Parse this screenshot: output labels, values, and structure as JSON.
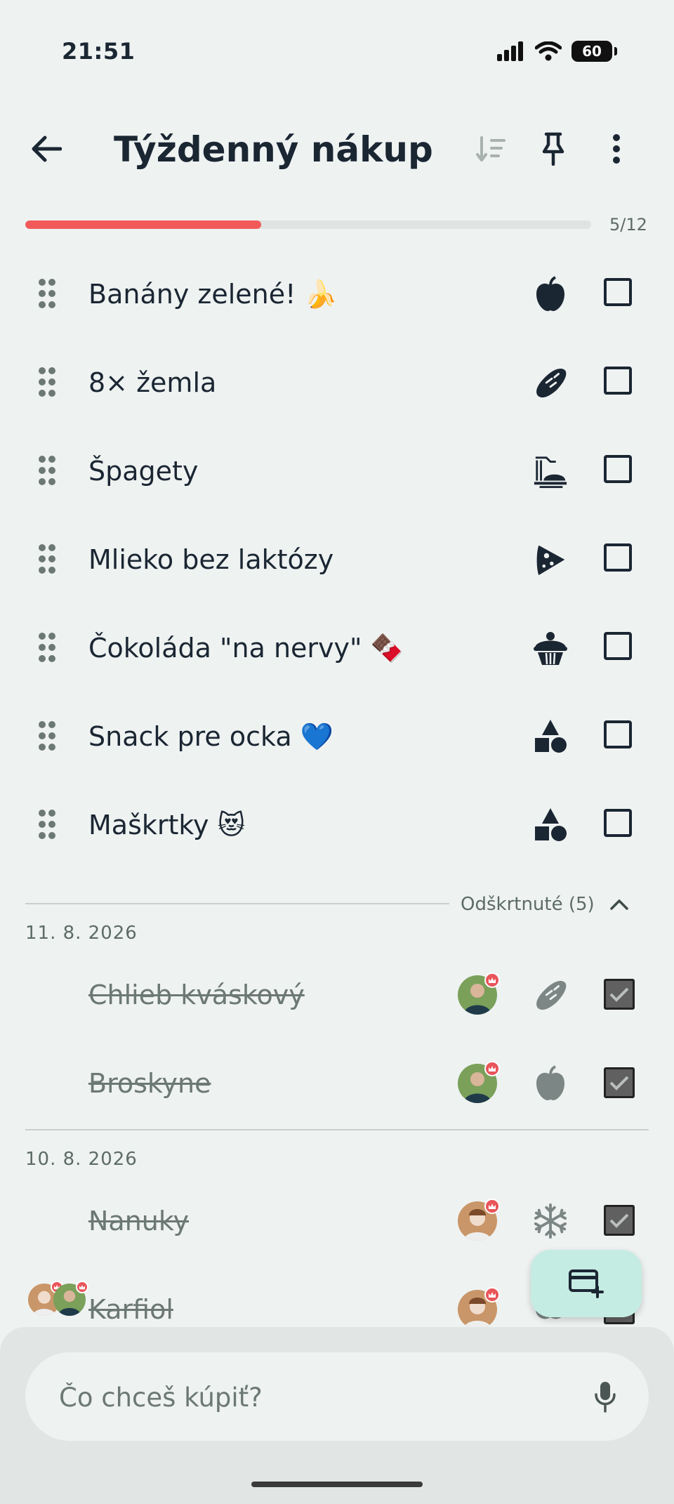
{
  "status_bar": {
    "time": "21:51",
    "battery": "60"
  },
  "header": {
    "title": "Týždenný nákup"
  },
  "progress": {
    "done": 5,
    "total": 12,
    "label": "5/12"
  },
  "items": [
    {
      "label": "Banány zelené! 🍌",
      "category_icon": "apple-icon"
    },
    {
      "label": "8× žemla",
      "category_icon": "bread-icon"
    },
    {
      "label": "Špagety",
      "category_icon": "pasta-icon"
    },
    {
      "label": "Mlieko bez laktózy",
      "category_icon": "cheese-icon"
    },
    {
      "label": "Čokoláda \"na nervy\" 🍫",
      "category_icon": "cupcake-icon"
    },
    {
      "label": "Snack pre ocka 💙",
      "category_icon": "shapes-icon"
    },
    {
      "label": "Maškrtky 😻",
      "category_icon": "shapes-icon"
    }
  ],
  "checked_section": {
    "label": "Odškrtnuté (5)",
    "groups": [
      {
        "date": "11. 8. 2026",
        "items": [
          {
            "label": "Chlieb kváskový",
            "category_icon": "bread-icon"
          },
          {
            "label": "Broskyne",
            "category_icon": "apple-icon"
          }
        ]
      },
      {
        "date": "10. 8. 2026",
        "items": [
          {
            "label": "Nanuky",
            "category_icon": "snowflake-icon"
          },
          {
            "label": "Karfiol",
            "category_icon": "vegetable-icon"
          }
        ]
      }
    ]
  },
  "search": {
    "placeholder": "Čo chceš kúpiť?"
  },
  "colors": {
    "background": "#eef2f1",
    "accent": "#f25a5a",
    "fab": "#c5ece2",
    "text": "#1b2633"
  }
}
